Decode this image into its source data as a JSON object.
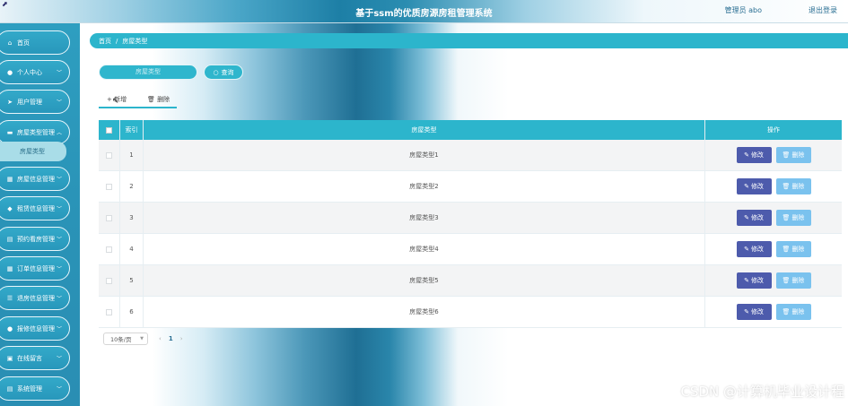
{
  "app": {
    "title": "基于ssm的优质房源房租管理系统",
    "user_label": "管理员 abo",
    "logout_label": "退出登录"
  },
  "sidebar": {
    "items": [
      {
        "label": "首页",
        "icon": "home-icon",
        "has_children": false
      },
      {
        "label": "个人中心",
        "icon": "user-icon",
        "has_children": true
      },
      {
        "label": "用户管理",
        "icon": "send-icon",
        "has_children": true
      },
      {
        "label": "房屋类型管理",
        "icon": "monitor-icon",
        "has_children": true,
        "expanded": true
      },
      {
        "label": "房屋信息管理",
        "icon": "grid-icon",
        "has_children": true
      },
      {
        "label": "租赁信息管理",
        "icon": "tag-icon",
        "has_children": true
      },
      {
        "label": "预约看房管理",
        "icon": "clipboard-icon",
        "has_children": true
      },
      {
        "label": "订单信息管理",
        "icon": "grid-icon",
        "has_children": true
      },
      {
        "label": "退房信息管理",
        "icon": "list-icon",
        "has_children": true
      },
      {
        "label": "报修信息管理",
        "icon": "user-icon",
        "has_children": true
      },
      {
        "label": "在线留言",
        "icon": "folder-icon",
        "has_children": true
      },
      {
        "label": "系统管理",
        "icon": "clipboard-icon",
        "has_children": true
      }
    ],
    "active_sub_item": "房屋类型"
  },
  "breadcrumb": {
    "home": "首页",
    "separator": "/",
    "current": "房屋类型"
  },
  "search": {
    "placeholder": "房屋类型",
    "button_label": "查询"
  },
  "actions": {
    "add_label": "+ 新增",
    "delete_label": "删除"
  },
  "table": {
    "headers": {
      "index": "索引",
      "type": "房屋类型",
      "operation": "操作"
    },
    "rows": [
      {
        "index": "1",
        "type": "房屋类型1"
      },
      {
        "index": "2",
        "type": "房屋类型2"
      },
      {
        "index": "3",
        "type": "房屋类型3"
      },
      {
        "index": "4",
        "type": "房屋类型4"
      },
      {
        "index": "5",
        "type": "房屋类型5"
      },
      {
        "index": "6",
        "type": "房屋类型6"
      }
    ],
    "edit_label": "修改",
    "delete_label": "删除"
  },
  "pagination": {
    "page_size": "10条/页",
    "prev": "‹",
    "current_page": "1",
    "next": "›"
  },
  "watermark": "CSDN @计算机毕业设计程",
  "colors": {
    "sidebar": "#2a93b7",
    "header_teal": "#2cb5cc",
    "edit_button": "#4d5bac",
    "delete_button": "#7ac2ee"
  }
}
